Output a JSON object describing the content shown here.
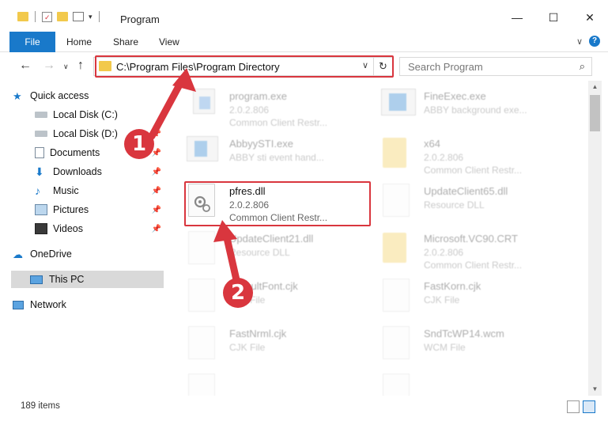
{
  "window": {
    "title": "Program",
    "minimize": "—",
    "maximize": "☐",
    "close": "✕"
  },
  "ribbon": {
    "tabs": [
      "File",
      "Home",
      "Share",
      "View"
    ],
    "help": "?",
    "collapse": "∨"
  },
  "addressbar": {
    "path": "C:\\Program Files\\Program Directory",
    "search_placeholder": "Search Program"
  },
  "sidebar": {
    "quick_access": "Quick access",
    "items": [
      {
        "label": "Local Disk (C:)",
        "icon": "drive-icon",
        "pinned": false
      },
      {
        "label": "Local Disk (D:)",
        "icon": "drive-icon",
        "pinned": true
      },
      {
        "label": "Documents",
        "icon": "documents-icon",
        "pinned": true
      },
      {
        "label": "Downloads",
        "icon": "downloads-icon",
        "pinned": true
      },
      {
        "label": "Music",
        "icon": "music-icon",
        "pinned": true
      },
      {
        "label": "Pictures",
        "icon": "pictures-icon",
        "pinned": true
      },
      {
        "label": "Videos",
        "icon": "videos-icon",
        "pinned": true
      }
    ],
    "onedrive": "OneDrive",
    "this_pc": "This PC",
    "network": "Network"
  },
  "files": {
    "left": [
      {
        "name": "program.exe",
        "line2": "2.0.2.806",
        "line3": "Common Client Restr...",
        "icon": "exe-icon",
        "blurred": true
      },
      {
        "name": "AbbyySTI.exe",
        "line2": "ABBY sti event hand...",
        "line3": "",
        "icon": "exe-icon",
        "blurred": true
      },
      {
        "name": "pfres.dll",
        "line2": "2.0.2.806",
        "line3": "Common Client Restr...",
        "icon": "dll-icon",
        "blurred": false
      },
      {
        "name": "UpdateClient21.dll",
        "line2": "Resource DLL",
        "line3": "",
        "icon": "dll-icon",
        "blurred": true
      },
      {
        "name": "DefaultFont.cjk",
        "line2": "CJK File",
        "line3": "",
        "icon": "file-icon",
        "blurred": true
      },
      {
        "name": "FastNrml.cjk",
        "line2": "CJK File",
        "line3": "",
        "icon": "file-icon",
        "blurred": true
      },
      {
        "name": "",
        "line2": "",
        "line3": "",
        "icon": "file-icon",
        "blurred": true
      }
    ],
    "right": [
      {
        "name": "FineExec.exe",
        "line2": "ABBY background exe...",
        "line3": "",
        "icon": "exe-icon",
        "blurred": true
      },
      {
        "name": "x64",
        "line2": "2.0.2.806",
        "line3": "Common Client Restr...",
        "icon": "folder-icon",
        "blurred": true
      },
      {
        "name": "UpdateClient65.dll",
        "line2": "Resource DLL",
        "line3": "",
        "icon": "dll-icon",
        "blurred": true
      },
      {
        "name": "Microsoft.VC90.CRT",
        "line2": "2.0.2.806",
        "line3": "Common Client Restr...",
        "icon": "folder-icon",
        "blurred": true
      },
      {
        "name": "FastKorn.cjk",
        "line2": "CJK File",
        "line3": "",
        "icon": "file-icon",
        "blurred": true
      },
      {
        "name": "SndTcWP14.wcm",
        "line2": "WCM File",
        "line3": "",
        "icon": "file-icon",
        "blurred": true
      },
      {
        "name": "",
        "line2": "",
        "line3": "",
        "icon": "file-icon",
        "blurred": true
      }
    ]
  },
  "status": {
    "item_count": "189 items"
  },
  "annotations": {
    "badge1": "1",
    "badge2": "2",
    "color": "#d9363e"
  }
}
